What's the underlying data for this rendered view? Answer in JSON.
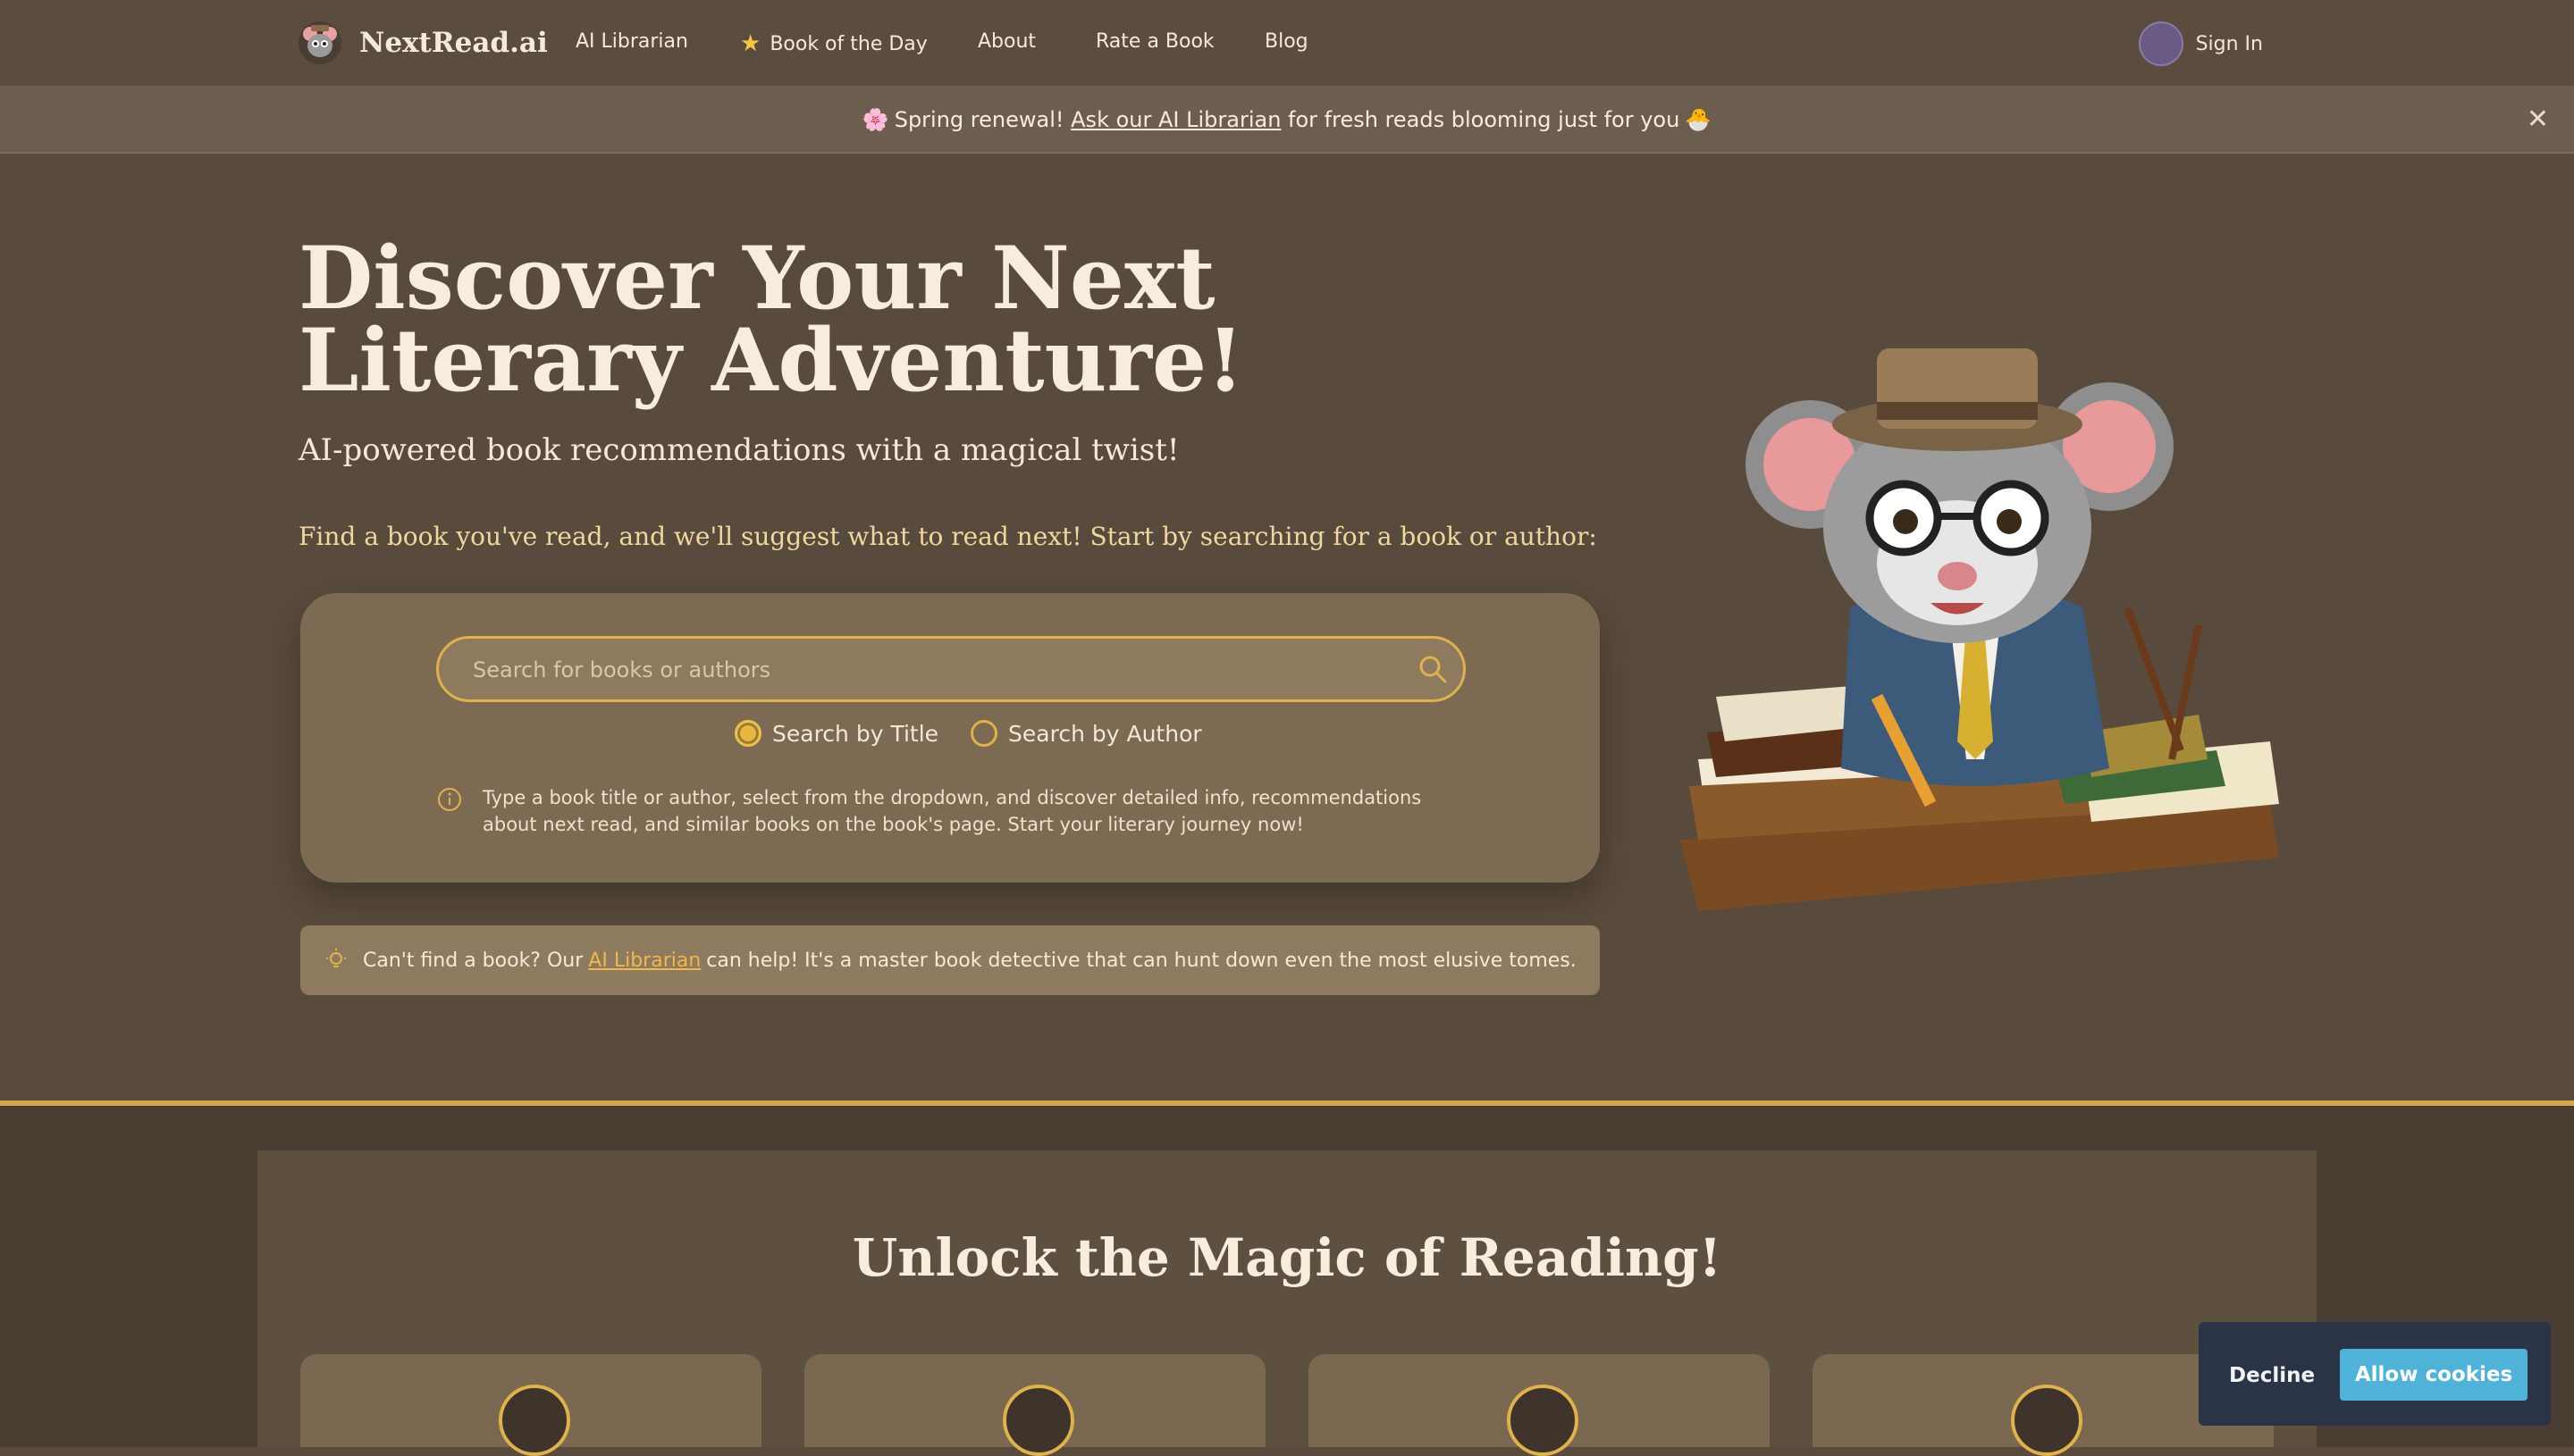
{
  "nav": {
    "brand": "NextRead.ai",
    "items": [
      {
        "label": "AI Librarian"
      },
      {
        "label": "Book of the Day",
        "icon": "star-icon"
      },
      {
        "label": "About"
      },
      {
        "label": "Rate a Book"
      },
      {
        "label": "Blog"
      }
    ],
    "signin": "Sign In"
  },
  "banner": {
    "emoji_left": "🌸",
    "prefix": "Spring renewal!",
    "link": "Ask our AI Librarian",
    "suffix": "for fresh reads blooming just for you",
    "emoji_right": "🐣"
  },
  "hero": {
    "title": "Discover Your Next Literary Adventure!",
    "subtitle": "AI-powered book recommendations with a magical twist!",
    "instructions": "Find a book you've read, and we'll suggest what to read next! Start by searching for a book or author:"
  },
  "search": {
    "placeholder": "Search for books or authors",
    "options": [
      {
        "label": "Search by Title",
        "selected": true
      },
      {
        "label": "Search by Author",
        "selected": false
      }
    ],
    "info": "Type a book title or author, select from the dropdown, and discover detailed info, recommendations about next read, and similar books on the book's page. Start your literary journey now!"
  },
  "tip": {
    "prefix": "Can't find a book? Our",
    "link": "AI Librarian",
    "suffix": "can help! It's a master book detective that can hunt down even the most elusive tomes."
  },
  "features": {
    "title": "Unlock the Magic of Reading!"
  },
  "cookie": {
    "decline": "Decline",
    "allow": "Allow cookies"
  },
  "colors": {
    "background": "#584a3c",
    "accent": "#e0b24a",
    "cookie_button": "#4fb3d9"
  }
}
